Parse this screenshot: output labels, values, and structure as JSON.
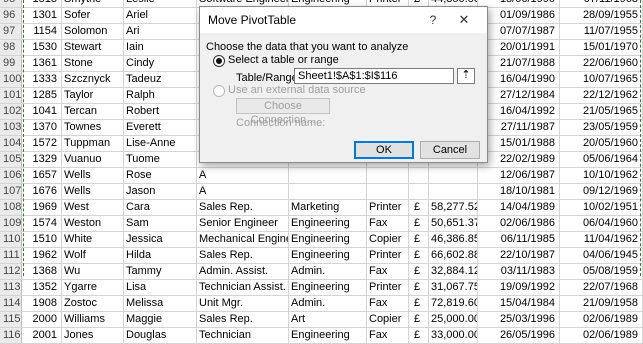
{
  "spreadsheet": {
    "rows": [
      {
        "rn": "95",
        "id": "1518",
        "last": "Smythe",
        "first": "Leslie",
        "job": "Software Engineer",
        "dept": "Engineering",
        "device": "Printer",
        "cur": "£",
        "amount": "44,350.50",
        "date1": "18/06/1990",
        "date2": "07/11/1963"
      },
      {
        "rn": "96",
        "id": "1301",
        "last": "Sofer",
        "first": "Ariel",
        "job": "S",
        "dept": "",
        "device": "",
        "cur": "",
        "amount": "",
        "date1": "01/09/1986",
        "date2": "28/09/1955"
      },
      {
        "rn": "97",
        "id": "1154",
        "last": "Solomon",
        "first": "Ari",
        "job": "S",
        "dept": "",
        "device": "",
        "cur": "",
        "amount": "",
        "date1": "07/07/1987",
        "date2": "11/07/1955"
      },
      {
        "rn": "98",
        "id": "1530",
        "last": "Stewart",
        "first": "Iain",
        "job": "A",
        "dept": "",
        "device": "",
        "cur": "",
        "amount": "",
        "date1": "20/01/1991",
        "date2": "15/01/1970"
      },
      {
        "rn": "99",
        "id": "1361",
        "last": "Stone",
        "first": "Cindy",
        "job": "T",
        "dept": "",
        "device": "",
        "cur": "",
        "amount": "",
        "date1": "21/07/1988",
        "date2": "22/06/1960"
      },
      {
        "rn": "100",
        "id": "1333",
        "last": "Szcznyck",
        "first": "Tadeuz",
        "job": "T",
        "dept": "",
        "device": "",
        "cur": "",
        "amount": "",
        "date1": "16/04/1990",
        "date2": "10/07/1965"
      },
      {
        "rn": "101",
        "id": "1285",
        "last": "Taylor",
        "first": "Ralph",
        "job": "A",
        "dept": "",
        "device": "",
        "cur": "",
        "amount": "",
        "date1": "27/12/1984",
        "date2": "22/12/1962"
      },
      {
        "rn": "102",
        "id": "1041",
        "last": "Tercan",
        "first": "Robert",
        "job": "G",
        "dept": "",
        "device": "",
        "cur": "",
        "amount": "",
        "date1": "16/04/1992",
        "date2": "21/05/1965"
      },
      {
        "rn": "103",
        "id": "1370",
        "last": "Townes",
        "first": "Everett",
        "job": "R",
        "dept": "",
        "device": "",
        "cur": "",
        "amount": "",
        "date1": "27/11/1987",
        "date2": "23/05/1959"
      },
      {
        "rn": "104",
        "id": "1572",
        "last": "Tuppman",
        "first": "Lise-Anne",
        "job": "T",
        "dept": "",
        "device": "",
        "cur": "",
        "amount": "",
        "date1": "15/01/1988",
        "date2": "20/05/1960"
      },
      {
        "rn": "105",
        "id": "1329",
        "last": "Vuanuo",
        "first": "Tuome",
        "job": "T",
        "dept": "",
        "device": "",
        "cur": "",
        "amount": "",
        "date1": "22/02/1989",
        "date2": "05/06/1964"
      },
      {
        "rn": "106",
        "id": "1657",
        "last": "Wells",
        "first": "Rose",
        "job": "A",
        "dept": "",
        "device": "",
        "cur": "",
        "amount": "",
        "date1": "12/06/1987",
        "date2": "10/10/1962"
      },
      {
        "rn": "107",
        "id": "1676",
        "last": "Wells",
        "first": "Jason",
        "job": "A",
        "dept": "",
        "device": "",
        "cur": "",
        "amount": "",
        "date1": "18/10/1981",
        "date2": "09/12/1969"
      },
      {
        "rn": "108",
        "id": "1969",
        "last": "West",
        "first": "Cara",
        "job": "Sales Rep.",
        "dept": "Marketing",
        "device": "Printer",
        "cur": "£",
        "amount": "58,277.52",
        "date1": "14/04/1989",
        "date2": "10/02/1951"
      },
      {
        "rn": "109",
        "id": "1574",
        "last": "Weston",
        "first": "Sam",
        "job": "Senior Engineer",
        "dept": "Engineering",
        "device": "Fax",
        "cur": "£",
        "amount": "50,651.37",
        "date1": "02/06/1986",
        "date2": "06/04/1960"
      },
      {
        "rn": "110",
        "id": "1510",
        "last": "White",
        "first": "Jessica",
        "job": "Mechanical Engineer",
        "dept": "Engineering",
        "device": "Copier",
        "cur": "£",
        "amount": "46,386.85",
        "date1": "06/11/1985",
        "date2": "11/04/1962"
      },
      {
        "rn": "111",
        "id": "1962",
        "last": "Wolf",
        "first": "Hilda",
        "job": "Sales Rep.",
        "dept": "Engineering",
        "device": "Printer",
        "cur": "£",
        "amount": "66,602.88",
        "date1": "22/10/1987",
        "date2": "04/06/1945"
      },
      {
        "rn": "112",
        "id": "1368",
        "last": "Wu",
        "first": "Tammy",
        "job": "Admin. Assist.",
        "dept": "Admin.",
        "device": "Fax",
        "cur": "£",
        "amount": "32,884.12",
        "date1": "03/11/1983",
        "date2": "05/08/1959"
      },
      {
        "rn": "113",
        "id": "1352",
        "last": "Ygarre",
        "first": "Lisa",
        "job": "Technician Assist.",
        "dept": "Engineering",
        "device": "Printer",
        "cur": "£",
        "amount": "31,067.75",
        "date1": "19/09/1992",
        "date2": "22/07/1968"
      },
      {
        "rn": "114",
        "id": "1908",
        "last": "Zostoc",
        "first": "Melissa",
        "job": "Unit Mgr.",
        "dept": "Admin.",
        "device": "Fax",
        "cur": "£",
        "amount": "72,819.60",
        "date1": "15/04/1984",
        "date2": "21/09/1958"
      },
      {
        "rn": "115",
        "id": "2000",
        "last": "Williams",
        "first": "Maggie",
        "job": "Sales Rep.",
        "dept": "Art",
        "device": "Copier",
        "cur": "£",
        "amount": "25,000.00",
        "date1": "25/03/1996",
        "date2": "02/06/1989"
      },
      {
        "rn": "116",
        "id": "2001",
        "last": "Jones",
        "first": "Douglas",
        "job": "Technician",
        "dept": "Engineering",
        "device": "Fax",
        "cur": "£",
        "amount": "33,000.00",
        "date1": "26/05/1996",
        "date2": "02/06/1989"
      }
    ]
  },
  "dialog": {
    "title": "Move PivotTable",
    "help_glyph": "?",
    "close_glyph": "✕",
    "section_label": "Choose the data that you want to analyze",
    "option_table": "Select a table or range",
    "range_label": "Table/Range:",
    "range_value": "Sheet1!$A$1:$I$116",
    "collapse_glyph": "⇡",
    "option_external": "Use an external data source",
    "choose_connection": "Choose Connection...",
    "connection_name_label": "Connection name:",
    "ok": "OK",
    "cancel": "Cancel"
  }
}
